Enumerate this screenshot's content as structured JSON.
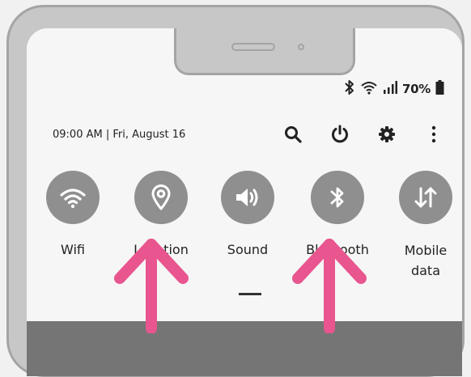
{
  "status_bar": {
    "battery": "70%",
    "icons": [
      "bluetooth-icon",
      "wifi-icon",
      "signal-icon",
      "battery-icon"
    ]
  },
  "header": {
    "datetime": "09:00 AM | Fri, August 16",
    "actions": [
      "search-icon",
      "power-icon",
      "gear-icon",
      "more-icon"
    ]
  },
  "quick_toggles": [
    {
      "label": "Wifi",
      "icon": "wifi-icon"
    },
    {
      "label": "Location",
      "icon": "location-icon"
    },
    {
      "label": "Sound",
      "icon": "sound-icon"
    },
    {
      "label": "Bluetooth",
      "icon": "bluetooth-icon"
    },
    {
      "label": "Mobile\ndata",
      "icon": "mobile-data-icon"
    }
  ],
  "colors": {
    "toggle_circle": "#8f8f8f",
    "arrow": "#e8558f",
    "frame": "#c7c7c7"
  }
}
